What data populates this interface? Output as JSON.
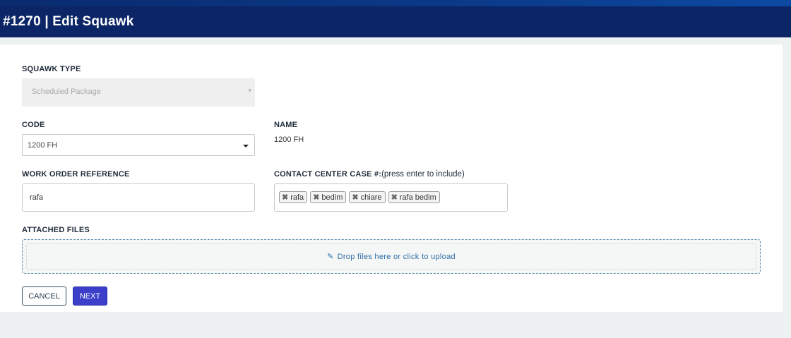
{
  "header": {
    "title": "#1270 | Edit Squawk"
  },
  "form": {
    "squawk_type": {
      "label": "SQUAWK TYPE",
      "value": "Scheduled Package",
      "caret": "▾"
    },
    "code": {
      "label": "CODE",
      "value": "1200 FH"
    },
    "name": {
      "label": "NAME",
      "value": "1200 FH"
    },
    "work_order": {
      "label": "WORK ORDER REFERENCE",
      "value": "rafa"
    },
    "contact_case": {
      "label": "CONTACT CENTER CASE #:",
      "hint": "(press enter to include)",
      "tags": [
        "rafa",
        "bedim",
        "chiare",
        "rafa bedim"
      ],
      "remove_glyph": "✖"
    },
    "attached_files": {
      "label": "ATTACHED FILES",
      "dropzone_text": "Drop files here or click to upload",
      "clip_glyph": "✎"
    }
  },
  "actions": {
    "cancel_label": "CANCEL",
    "next_label": "NEXT"
  },
  "colors": {
    "header_bg": "#0b2566",
    "primary": "#3b3fc9",
    "dropzone_border": "#5b8fb0"
  }
}
